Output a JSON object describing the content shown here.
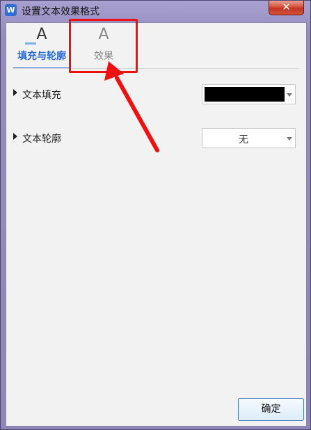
{
  "window": {
    "title": "设置文本效果格式",
    "app_icon_letter": "W",
    "close_glyph": "✕"
  },
  "tabs": [
    {
      "label": "填充与轮廓",
      "icon": "text-fill-icon",
      "icon_glyph": "A",
      "active": true
    },
    {
      "label": "效果",
      "icon": "text-effect-icon",
      "icon_glyph": "A",
      "active": false
    }
  ],
  "rows": [
    {
      "label": "文本填充",
      "control": "color-dropdown",
      "value_color": "#000000"
    },
    {
      "label": "文本轮廓",
      "control": "dropdown",
      "value": "无"
    }
  ],
  "buttons": {
    "ok": "确定"
  },
  "annotation": {
    "color": "#ee1111"
  },
  "colors": {
    "accent": "#2a6bd1",
    "title_bar": "#958dc0",
    "panel": "#f2f2f2"
  }
}
